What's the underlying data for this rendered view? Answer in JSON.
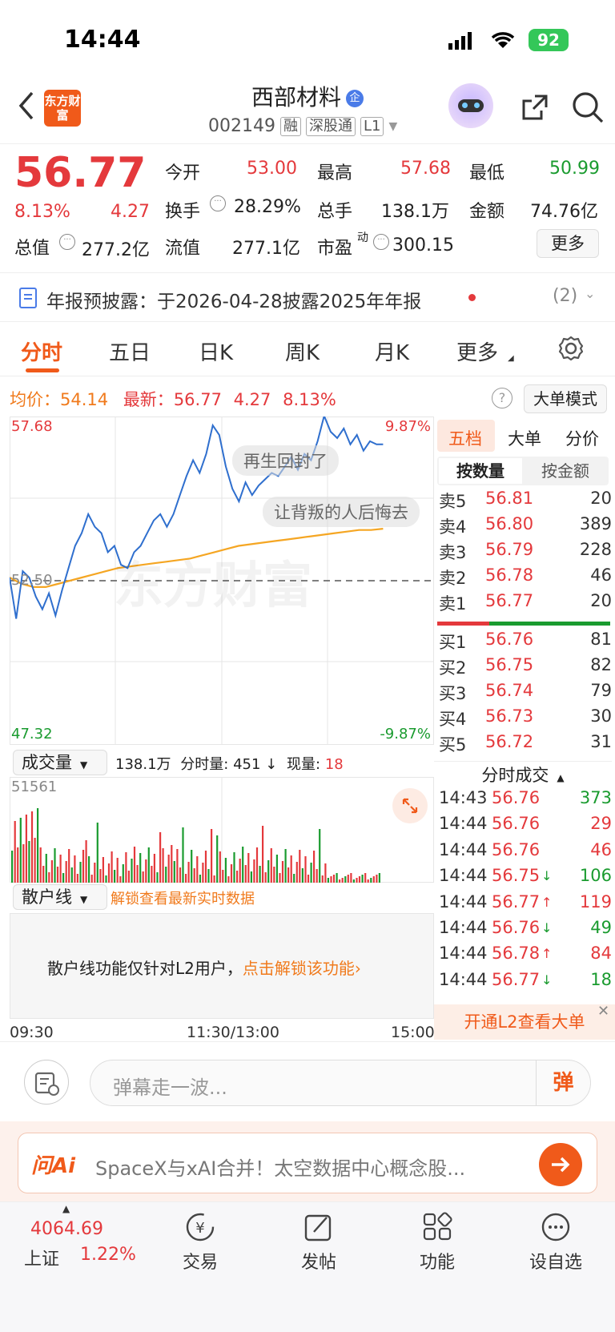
{
  "status": {
    "time": "14:44",
    "battery": "92"
  },
  "header": {
    "title": "西部材料",
    "code": "002149",
    "tags": [
      "融",
      "深股通",
      "L1"
    ],
    "logo": "东方财富",
    "share_icon": "share-icon",
    "search_icon": "search-icon"
  },
  "quote": {
    "price": "56.77",
    "change_pct": "8.13%",
    "change": "4.27",
    "open_label": "今开",
    "open": "53.00",
    "high_label": "最高",
    "high": "57.68",
    "low_label": "最低",
    "low": "50.99",
    "turnover_label": "换手",
    "turnover": "28.29%",
    "volume_label": "总手",
    "volume": "138.1万",
    "amount_label": "金额",
    "amount": "74.76亿",
    "mcap_label": "总值",
    "mcap": "277.2亿",
    "float_label": "流值",
    "float": "277.1亿",
    "pe_label": "市盈",
    "pe_sup": "动",
    "pe": "300.15",
    "more": "更多"
  },
  "notice": {
    "text": "年报预披露：于2026-04-28披露2025年年报",
    "count": "(2)"
  },
  "tabs": [
    "分时",
    "五日",
    "日K",
    "周K",
    "月K",
    "更多"
  ],
  "chart_header": {
    "avg_label": "均价：",
    "avg": "54.14",
    "latest_label": "最新：",
    "latest": "56.77",
    "chg": "4.27",
    "pct": "8.13%",
    "mode": "大单模式"
  },
  "chart_data": {
    "type": "line",
    "ylim": [
      47.32,
      57.68
    ],
    "y_top_label": "57.68",
    "y_bottom_label": "47.32",
    "y_mid_label": "52.50",
    "pct_top": "9.87%",
    "pct_bottom": "-9.87%",
    "x_labels": [
      "09:30",
      "11:30/13:00",
      "15:00"
    ],
    "prev_close": 52.5,
    "price": [
      52.6,
      51.3,
      52.8,
      52.6,
      52.0,
      51.6,
      52.1,
      51.4,
      52.2,
      52.9,
      53.6,
      54.0,
      54.6,
      54.2,
      54.0,
      53.4,
      53.6,
      53.0,
      52.9,
      53.4,
      53.6,
      54.0,
      54.4,
      54.6,
      54.2,
      54.6,
      55.2,
      55.8,
      56.3,
      55.9,
      56.5,
      57.4,
      57.1,
      56.1,
      55.4,
      55.0,
      55.6,
      55.2,
      55.5,
      55.7,
      55.9,
      55.8,
      56.1,
      56.4,
      56.0,
      56.5,
      56.3,
      56.9,
      57.7,
      57.2,
      57.0,
      57.3,
      56.8,
      57.1,
      56.6,
      56.9,
      56.8,
      56.8
    ],
    "avg": [
      52.6,
      52.4,
      52.3,
      52.3,
      52.4,
      52.5,
      52.6,
      52.7,
      52.8,
      52.9,
      52.95,
      53.0,
      53.05,
      53.1,
      53.15,
      53.2,
      53.3,
      53.4,
      53.5,
      53.6,
      53.65,
      53.7,
      53.75,
      53.8,
      53.85,
      53.9,
      53.95,
      54.0,
      54.05,
      54.1,
      54.1,
      54.14
    ],
    "volume_title": "成交量",
    "volume_max": "51561",
    "volume_total": "138.1万",
    "volume_interval_label": "分时量:",
    "volume_interval": "451",
    "volume_now_label": "现量:",
    "volume_now": "18"
  },
  "watermark": "东方财富",
  "danmaku": [
    "再生回封了",
    "让背叛的人后悔去"
  ],
  "retail": {
    "label": "散户线",
    "unlock_hint": "解锁查看最新实时数据",
    "locked_text": "散户线功能仅针对L2用户，",
    "unlock_link": "点击解锁该功能"
  },
  "orderbook": {
    "tabs": [
      "五档",
      "大单",
      "分价"
    ],
    "subtabs": [
      "按数量",
      "按金额"
    ],
    "asks": [
      {
        "label": "卖5",
        "price": "56.81",
        "qty": "20"
      },
      {
        "label": "卖4",
        "price": "56.80",
        "qty": "389"
      },
      {
        "label": "卖3",
        "price": "56.79",
        "qty": "228"
      },
      {
        "label": "卖2",
        "price": "56.78",
        "qty": "46"
      },
      {
        "label": "卖1",
        "price": "56.77",
        "qty": "20"
      }
    ],
    "bids": [
      {
        "label": "买1",
        "price": "56.76",
        "qty": "81"
      },
      {
        "label": "买2",
        "price": "56.75",
        "qty": "82"
      },
      {
        "label": "买3",
        "price": "56.74",
        "qty": "79"
      },
      {
        "label": "买4",
        "price": "56.73",
        "qty": "30"
      },
      {
        "label": "买5",
        "price": "56.72",
        "qty": "31"
      }
    ],
    "ticks_title": "分时成交",
    "ticks": [
      {
        "t": "14:43",
        "p": "56.76",
        "q": "373",
        "arrow": ""
      },
      {
        "t": "14:44",
        "p": "56.76",
        "q": "29",
        "arrow": ""
      },
      {
        "t": "14:44",
        "p": "56.76",
        "q": "46",
        "arrow": ""
      },
      {
        "t": "14:44",
        "p": "56.75",
        "q": "106",
        "arrow": "↓"
      },
      {
        "t": "14:44",
        "p": "56.77",
        "q": "119",
        "arrow": "↑"
      },
      {
        "t": "14:44",
        "p": "56.76",
        "q": "49",
        "arrow": "↓"
      },
      {
        "t": "14:44",
        "p": "56.78",
        "q": "84",
        "arrow": "↑"
      },
      {
        "t": "14:44",
        "p": "56.77",
        "q": "18",
        "arrow": "↓"
      }
    ],
    "l2_banner": "开通L2查看大单"
  },
  "comment": {
    "placeholder": "弹幕走一波...",
    "send": "弹"
  },
  "ai": {
    "logo": "问Ai",
    "text": "SpaceX与xAI合并！太空数据中心概念股..."
  },
  "nav": {
    "index_value": "4064.69",
    "index_name": "上证",
    "index_pct": "1.22%",
    "items": [
      "交易",
      "发帖",
      "功能",
      "设自选"
    ]
  }
}
